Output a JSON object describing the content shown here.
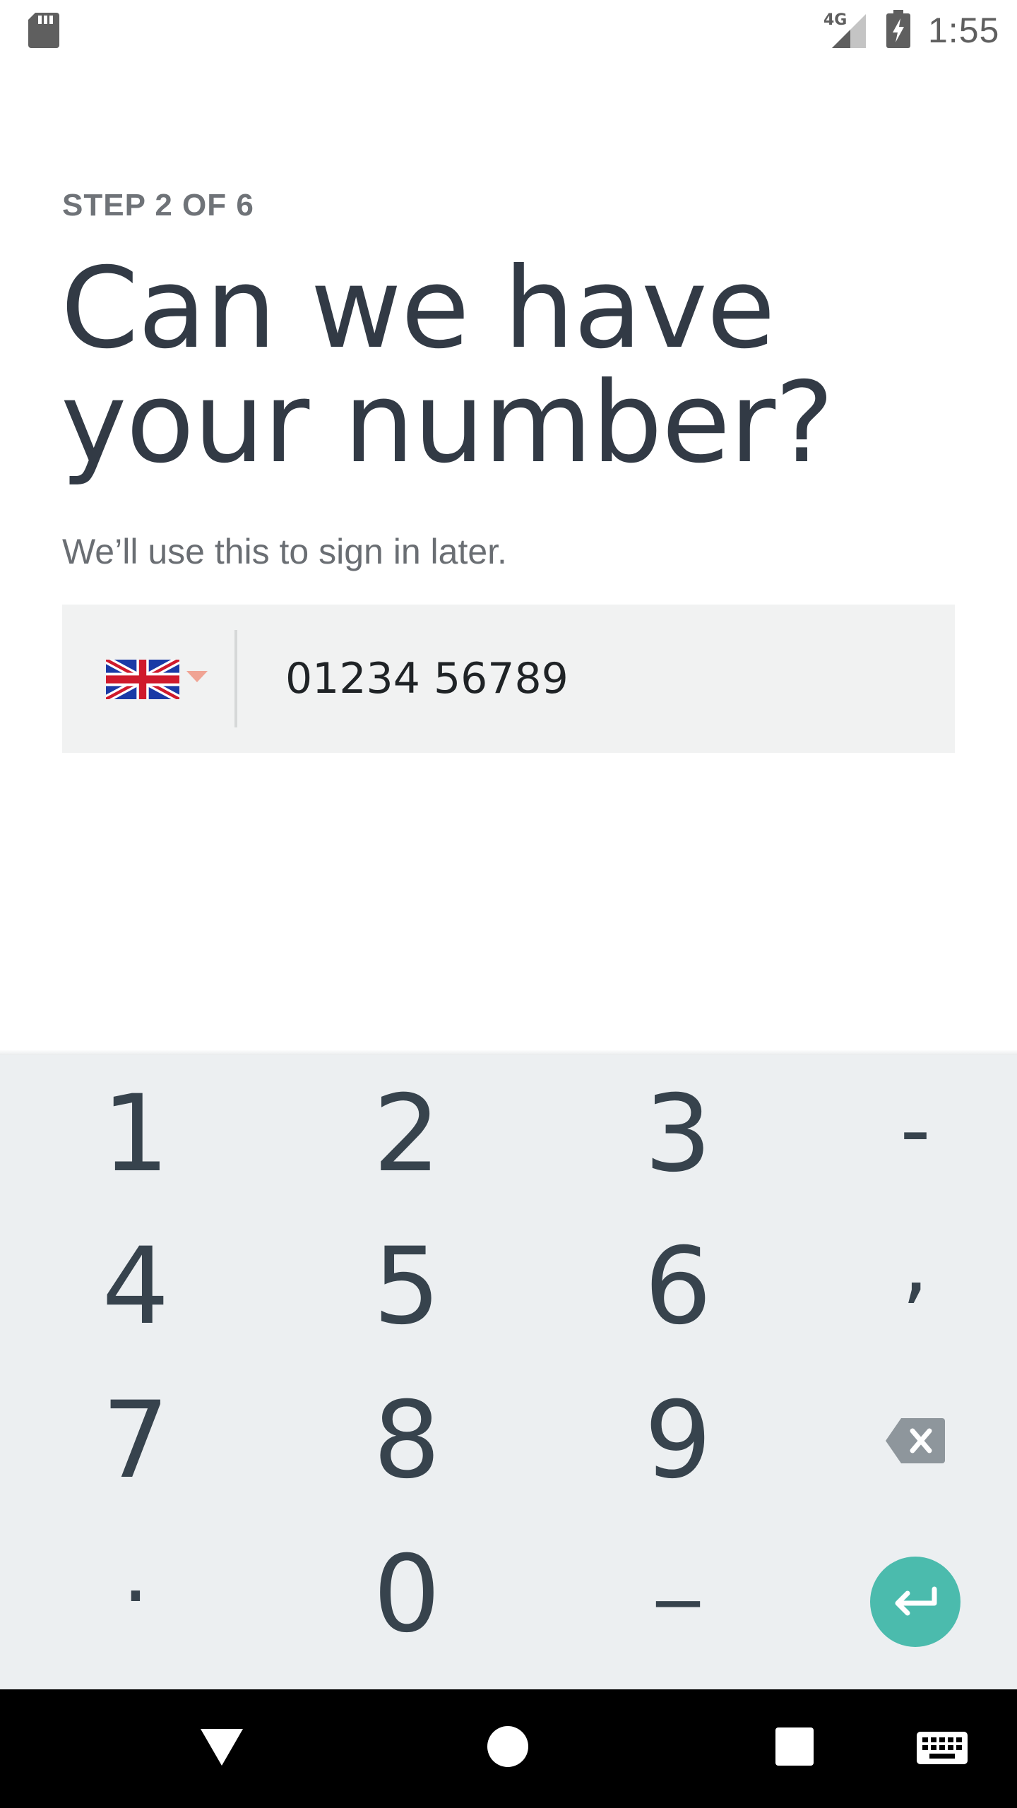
{
  "status_bar": {
    "network_label": "4G",
    "time": "1:55",
    "icons": [
      "sd-card-icon",
      "signal-icon",
      "battery-charging-icon"
    ]
  },
  "onboarding": {
    "step_label": "STEP 2 OF 6",
    "title": "Can we have your number?",
    "subtitle": "We’ll use this to sign in later.",
    "country_flag": "united-kingdom-flag-icon",
    "phone_value": "01234 56789"
  },
  "keyboard": {
    "rows": [
      [
        "1",
        "2",
        "3",
        "-"
      ],
      [
        "4",
        "5",
        "6",
        ","
      ],
      [
        "7",
        "8",
        "9",
        "backspace"
      ],
      [
        ".",
        "0",
        "_",
        "enter"
      ]
    ],
    "accent_color": "#4bbbad"
  },
  "navigation": {
    "buttons": [
      "back",
      "home",
      "recents",
      "keyboard-switch"
    ]
  }
}
